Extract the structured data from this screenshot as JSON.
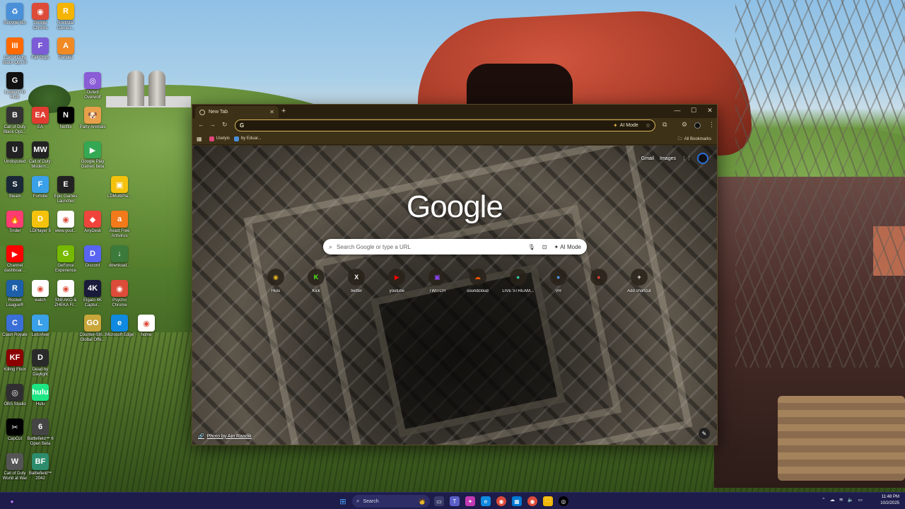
{
  "desktop": {
    "icons": [
      {
        "label": "Recycle Bin",
        "color": "#4a90d9",
        "glyph": "♻"
      },
      {
        "label": "Google Chrome",
        "color": "#dd4b39",
        "glyph": "◉"
      },
      {
        "label": "Rockstar Games...",
        "color": "#f4b400",
        "glyph": "R"
      },
      {
        "label": "Call of Duty Black Ops III",
        "color": "#ff6a00",
        "glyph": "III"
      },
      {
        "label": "Fall Guys",
        "color": "#7b5cd6",
        "glyph": "F"
      },
      {
        "label": "Parallel",
        "color": "#f08a24",
        "glyph": "A"
      },
      {
        "label": "Logitech G HUB",
        "color": "#111111",
        "glyph": "G"
      },
      {
        "label": "Outwit Overwolf",
        "color": "#8a5cd6",
        "glyph": "◎"
      },
      {
        "label": "Call of Duty Black Ops...",
        "color": "#333333",
        "glyph": "B"
      },
      {
        "label": "EA",
        "color": "#e03c31",
        "glyph": "EA"
      },
      {
        "label": "Netflix",
        "color": "#000000",
        "glyph": "N"
      },
      {
        "label": "Party Animals",
        "color": "#e8a04a",
        "glyph": "🐶"
      },
      {
        "label": "Undisputed",
        "color": "#222222",
        "glyph": "U"
      },
      {
        "label": "Call of Duty: Modern...",
        "color": "#222222",
        "glyph": "MW"
      },
      {
        "label": "Google Play Games beta",
        "color": "#34a853",
        "glyph": "▶"
      },
      {
        "label": "Steam",
        "color": "#1b2838",
        "glyph": "S"
      },
      {
        "label": "Fortnite",
        "color": "#3aa0e8",
        "glyph": "F"
      },
      {
        "label": "Epic Games Launcher",
        "color": "#222222",
        "glyph": "E"
      },
      {
        "label": "LDMultiPla...",
        "color": "#f4c20d",
        "glyph": "▣"
      },
      {
        "label": "Tinder",
        "color": "#fe3c72",
        "glyph": "🔥"
      },
      {
        "label": "LDPlayer 9",
        "color": "#f4c20d",
        "glyph": "D"
      },
      {
        "label": "www.yout...",
        "color": "#ffffff",
        "glyph": "◉"
      },
      {
        "label": "AnyDesk",
        "color": "#ef443b",
        "glyph": "◆"
      },
      {
        "label": "Avast Free Antivirus",
        "color": "#f27a1a",
        "glyph": "a"
      },
      {
        "label": "Channel dashboar...",
        "color": "#ff0000",
        "glyph": "▶"
      },
      {
        "label": "GeForce Experience",
        "color": "#76b900",
        "glyph": "G"
      },
      {
        "label": "Discord",
        "color": "#5865f2",
        "glyph": "D"
      },
      {
        "label": "download...",
        "color": "#3b7a3b",
        "glyph": "↓"
      },
      {
        "label": "Rocket League®",
        "color": "#1d5fa8",
        "glyph": "R"
      },
      {
        "label": "watch",
        "color": "#ffffff",
        "glyph": "◉"
      },
      {
        "label": "SNEAKO & ZHEKA FI...",
        "color": "#ffffff",
        "glyph": "◉"
      },
      {
        "label": "Elgato 4K Captur...",
        "color": "#1a1a3a",
        "glyph": "4K"
      },
      {
        "label": "Psycho Chrome",
        "color": "#dd4b39",
        "glyph": "◉"
      },
      {
        "label": "Clash Royale",
        "color": "#3a6fd8",
        "glyph": "C"
      },
      {
        "label": "LetsView",
        "color": "#3aa0e8",
        "glyph": "L"
      },
      {
        "label": "Counter-Stri... Global Offe...",
        "color": "#c8a63a",
        "glyph": "GO"
      },
      {
        "label": "Microsoft Edge",
        "color": "#0f8ae0",
        "glyph": "e"
      },
      {
        "label": "home",
        "color": "#ffffff",
        "glyph": "◉"
      },
      {
        "label": "Killing Floor",
        "color": "#8b0000",
        "glyph": "KF"
      },
      {
        "label": "Dead by Daylight",
        "color": "#2a2a2a",
        "glyph": "D"
      },
      {
        "label": "OBS Studio",
        "color": "#302e31",
        "glyph": "◎"
      },
      {
        "label": "Hulu",
        "color": "#1ce783",
        "glyph": "hulu"
      },
      {
        "label": "CapCut",
        "color": "#000000",
        "glyph": "✂"
      },
      {
        "label": "Battlefield™ 6 Open Beta",
        "color": "#444444",
        "glyph": "6"
      },
      {
        "label": "Call of Duty World at War",
        "color": "#555555",
        "glyph": "W"
      },
      {
        "label": "Battlefield™ 2042",
        "color": "#2c8c6c",
        "glyph": "BF"
      }
    ]
  },
  "browser": {
    "tab_title": "New Tab",
    "new_tab_symbol": "+",
    "omnibox": {
      "value": "",
      "g_label": "G",
      "ai_mode_label": "AI Mode"
    },
    "bookmarks": [
      {
        "label": "Uselyis",
        "color": "#e0447a"
      },
      {
        "label": "by Eduar...",
        "color": "#4a90d9"
      }
    ],
    "all_bookmarks_label": "All Bookmarks"
  },
  "ntp": {
    "top_links": {
      "gmail": "Gmail",
      "images": "Images"
    },
    "logo_text": "Google",
    "search_placeholder": "Search Google or type a URL",
    "ai_mode_label": "AI Mode",
    "shortcuts": [
      {
        "label": "Hulu",
        "glyph": "◉",
        "color": "#e6b422"
      },
      {
        "label": "Kick",
        "glyph": "K",
        "color": "#53fc18"
      },
      {
        "label": "twitter",
        "glyph": "X",
        "color": "#ffffff"
      },
      {
        "label": "youtube",
        "glyph": "▶",
        "color": "#ff0000"
      },
      {
        "label": "TWITCH",
        "glyph": "▣",
        "color": "#9146ff"
      },
      {
        "label": "soundcloud",
        "glyph": "☁",
        "color": "#ff5500"
      },
      {
        "label": "LIVE STREAM...",
        "glyph": "●",
        "color": "#35c0a0"
      },
      {
        "label": "VR",
        "glyph": "●",
        "color": "#4a90e2"
      },
      {
        "label": "",
        "glyph": "●",
        "color": "#e03c31"
      },
      {
        "label": "Add shortcut",
        "glyph": "+",
        "color": "#ffffff"
      }
    ],
    "photo_credit": "Photo by Ain Raadik"
  },
  "taskbar": {
    "search_placeholder": "Search",
    "time": "11:48 PM",
    "date": "10/2/2025"
  }
}
